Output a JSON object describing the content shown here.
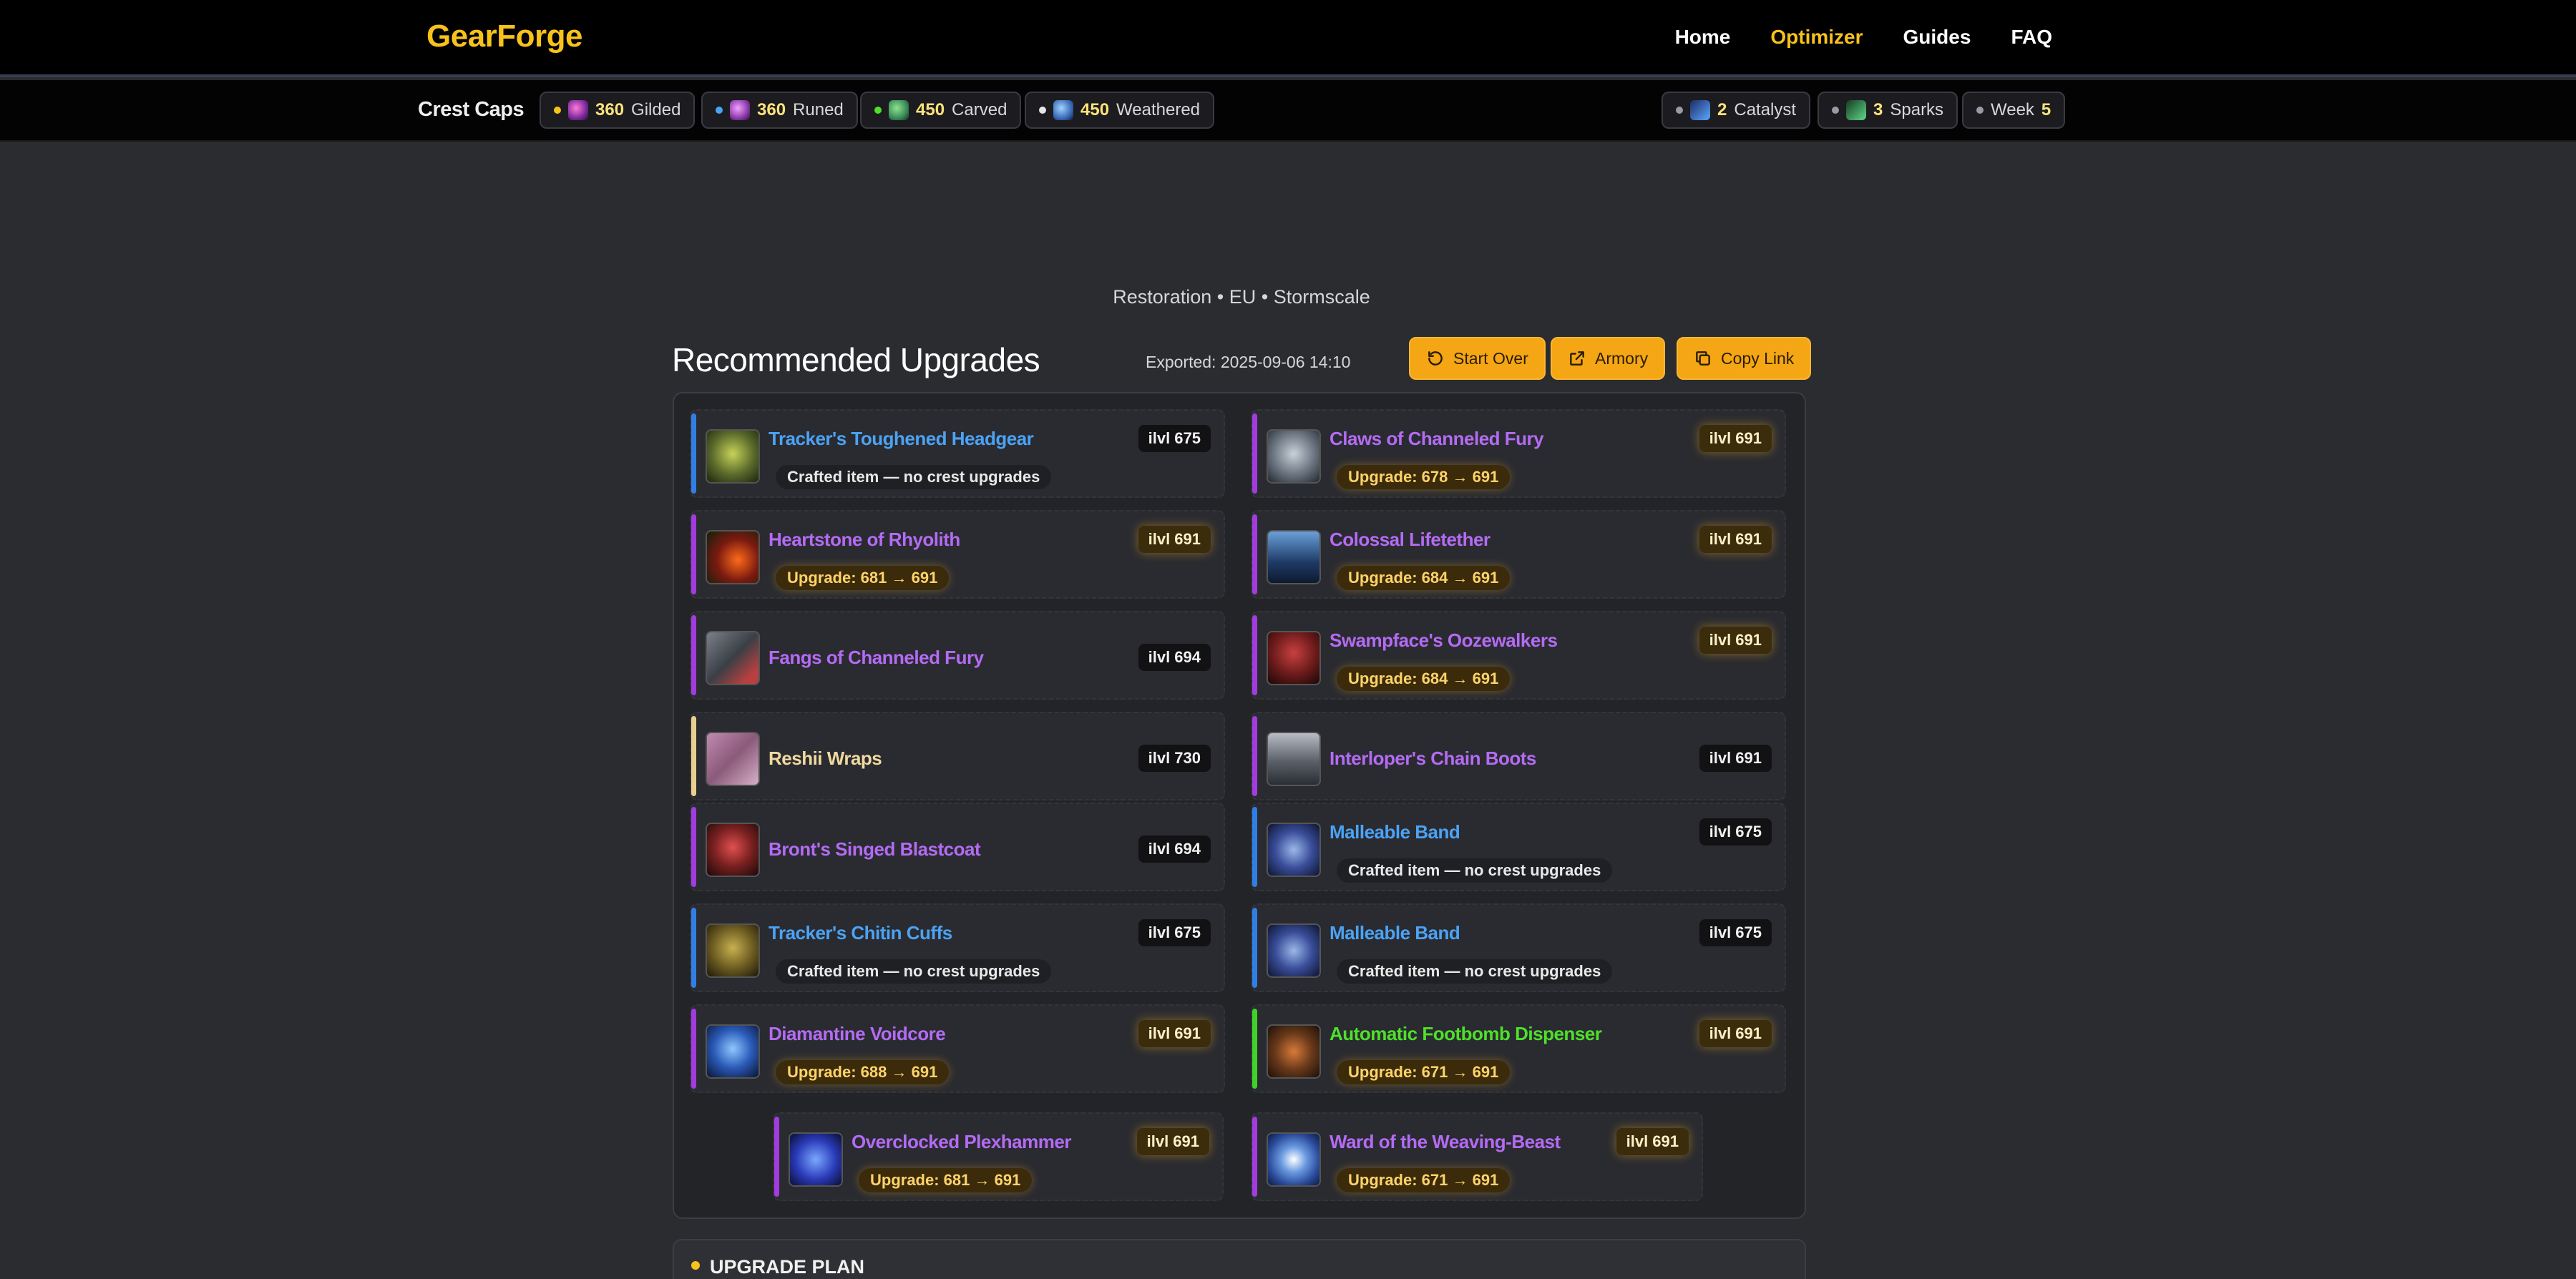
{
  "nav": {
    "logo": "GearForge",
    "links": [
      {
        "label": "Home",
        "active": false
      },
      {
        "label": "Optimizer",
        "active": true
      },
      {
        "label": "Guides",
        "active": false
      },
      {
        "label": "FAQ",
        "active": false
      }
    ]
  },
  "caps": {
    "title": "Crest Caps",
    "left": [
      {
        "value": "360",
        "label": "Gilded",
        "dot": "#f7c21a",
        "icon": "gilded-crest-icon"
      },
      {
        "value": "360",
        "label": "Runed",
        "dot": "#4ba3f5",
        "icon": "runed-crest-icon"
      },
      {
        "value": "450",
        "label": "Carved",
        "dot": "#4ee02a",
        "icon": "carved-crest-icon"
      },
      {
        "value": "450",
        "label": "Weathered",
        "dot": "#e6e6e6",
        "icon": "weathered-crest-icon"
      }
    ],
    "right": [
      {
        "value": "2",
        "label": "Catalyst",
        "icon": "catalyst-icon"
      },
      {
        "value": "3",
        "label": "Sparks",
        "icon": "spark-icon"
      },
      {
        "label": "Week",
        "value": "5"
      }
    ]
  },
  "header": {
    "subtitle": "Restoration • EU • Stormscale",
    "title": "Recommended Upgrades",
    "exported": "Exported: 2025-09-06 14:10",
    "buttons": {
      "start_over": "Start Over",
      "armory": "Armory",
      "copy_link": "Copy Link"
    }
  },
  "items": [
    {
      "name": "Tracker's Toughened Headgear",
      "ilvl": "ilvl 675",
      "tag": "Crafted item — no crest upgrades",
      "tagType": "crafted",
      "rarity": "blue"
    },
    {
      "name": "Claws of Channeled Fury",
      "ilvl": "ilvl 691",
      "tag": "Upgrade: 678 → 691",
      "tagType": "upgrade",
      "rarity": "purple"
    },
    {
      "name": "Heartstone of Rhyolith",
      "ilvl": "ilvl 691",
      "tag": "Upgrade: 681 → 691",
      "tagType": "upgrade",
      "rarity": "purple"
    },
    {
      "name": "Colossal Lifetether",
      "ilvl": "ilvl 691",
      "tag": "Upgrade: 684 → 691",
      "tagType": "upgrade",
      "rarity": "purple"
    },
    {
      "name": "Fangs of Channeled Fury",
      "ilvl": "ilvl 694",
      "tag": "",
      "tagType": "none",
      "rarity": "purple"
    },
    {
      "name": "Swampface's Oozewalkers",
      "ilvl": "ilvl 691",
      "tag": "Upgrade: 684 → 691",
      "tagType": "upgrade",
      "rarity": "purple"
    },
    {
      "name": "Reshii Wraps",
      "ilvl": "ilvl 730",
      "tag": "",
      "tagType": "none",
      "rarity": "beige"
    },
    {
      "name": "Interloper's Chain Boots",
      "ilvl": "ilvl 691",
      "tag": "",
      "tagType": "none",
      "rarity": "purple"
    },
    {
      "name": "Bront's Singed Blastcoat",
      "ilvl": "ilvl 694",
      "tag": "",
      "tagType": "none",
      "rarity": "purple"
    },
    {
      "name": "Malleable Band",
      "ilvl": "ilvl 675",
      "tag": "Crafted item — no crest upgrades",
      "tagType": "crafted",
      "rarity": "blue"
    },
    {
      "name": "Tracker's Chitin Cuffs",
      "ilvl": "ilvl 675",
      "tag": "Crafted item — no crest upgrades",
      "tagType": "crafted",
      "rarity": "blue"
    },
    {
      "name": "Malleable Band",
      "ilvl": "ilvl 675",
      "tag": "Crafted item — no crest upgrades",
      "tagType": "crafted",
      "rarity": "blue"
    },
    {
      "name": "Diamantine Voidcore",
      "ilvl": "ilvl 691",
      "tag": "Upgrade: 688 → 691",
      "tagType": "upgrade",
      "rarity": "purple"
    },
    {
      "name": "Automatic Footbomb Dispenser",
      "ilvl": "ilvl 691",
      "tag": "Upgrade: 671 → 691",
      "tagType": "upgrade",
      "rarity": "green"
    },
    {
      "name": "Overclocked Plexhammer",
      "ilvl": "ilvl 691",
      "tag": "Upgrade: 681 → 691",
      "tagType": "upgrade",
      "rarity": "purple"
    },
    {
      "name": "Ward of the Weaving-Beast",
      "ilvl": "ilvl 691",
      "tag": "Upgrade: 671 → 691",
      "tagType": "upgrade",
      "rarity": "purple"
    }
  ],
  "plan": {
    "title": "UPGRADE PLAN"
  },
  "colors": {
    "accent": "#f7c21a",
    "blue": "#4ba3f5",
    "purple": "#b46bf4",
    "beige": "#f0d9a0",
    "green": "#4ee02a",
    "button": "#f4a614"
  }
}
